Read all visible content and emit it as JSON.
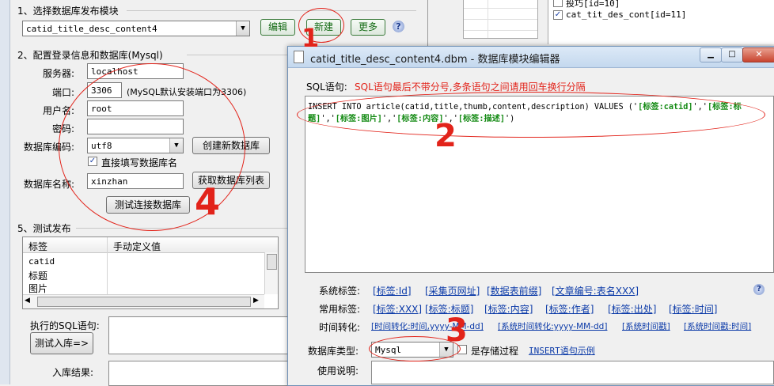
{
  "left": {
    "section1_title": "1、选择数据库发布模块",
    "module_value": "catid_title_desc_content4",
    "edit_label": "编辑",
    "new_label": "新建",
    "more_label": "更多",
    "section2_title": "2、配置登录信息和数据库(Mysql)",
    "server_label": "服务器:",
    "server_value": "localhost",
    "port_label": "端口:",
    "port_value": "3306",
    "port_hint": "(MySQL默认安装端口为3306)",
    "user_label": "用户名:",
    "user_value": "root",
    "pwd_label": "密码:",
    "pwd_value": "",
    "encoding_label": "数据库编码:",
    "encoding_value": "utf8",
    "create_db_label": "创建新数据库",
    "direct_db_label": "直接填写数据库名",
    "dbname_label": "数据库名称:",
    "dbname_value": "xinzhan",
    "get_db_list_label": "获取数据库列表",
    "test_conn_label": "测试连接数据库",
    "section5_title": "5、测试发布",
    "grid_headers": [
      "标签",
      "手动定义值"
    ],
    "grid_rows": [
      "catid",
      "标题",
      "图片"
    ],
    "exec_sql_label": "执行的SQL语句:",
    "test_insert_label": "测试入库=>",
    "result_label": "入库结果:"
  },
  "right_list": {
    "items": [
      {
        "label": "投巧[id=10]",
        "checked": false
      },
      {
        "label": "cat_tit_des_cont[id=11]",
        "checked": true
      }
    ]
  },
  "dialog": {
    "title": "catid_title_desc_content4.dbm - 数据库模块编辑器",
    "sql_label": "SQL语句:",
    "sql_hint": "SQL语句最后不带分号,多条语句之间请用回车换行分隔",
    "sql_line1_prefix": "INSERT INTO article(catid,title,thumb,content,description) VALUES ('",
    "sql_tag_catid": "[标签:catid]",
    "sql_sep": "','",
    "sql_tag_title_part1": "[标签:标",
    "sql_tag_title_part2": "题]",
    "sql_tag_image": "[标签:图片]",
    "sql_tag_content": "[标签:内容]",
    "sql_tag_desc": "[标签:描述]",
    "sql_end": "')",
    "sys_tags_label": "系统标签:",
    "sys_tags": [
      "[标签:Id]",
      "[采集页网址]",
      "[数据表前缀]",
      "[文章编号:表名XXX]"
    ],
    "common_tags_label": "常用标签:",
    "common_tags": [
      "[标签:XXX]",
      "[标签:标题]",
      "[标签:内容]",
      "[标签:作者]",
      "[标签:出处]",
      "[标签:时间]"
    ],
    "time_conv_label": "时间转化:",
    "time_conv": [
      "[时间转化:时间,yyyy-MM-dd]",
      "[系统时间转化:yyyy-MM-dd]",
      "[系统时间戳]",
      "[系统时间戳:时间]"
    ],
    "db_type_label": "数据库类型:",
    "db_type_value": "Mysql",
    "stored_proc_label": "是存储过程",
    "insert_example_label": "INSERT语句示例",
    "usage_label": "使用说明:"
  },
  "annotations": [
    "1",
    "2",
    "3",
    "4"
  ],
  "colors": {
    "annotation": "#e2231a",
    "link": "#0b3aa8",
    "tag": "#138a13",
    "hint": "#e2231a"
  }
}
